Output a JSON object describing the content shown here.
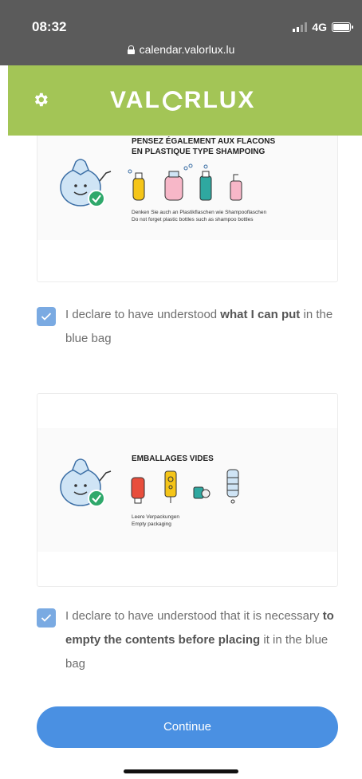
{
  "status_bar": {
    "time": "08:32",
    "network": "4G",
    "url": "calendar.valorlux.lu"
  },
  "header": {
    "logo_left": "VAL",
    "logo_right": "RLUX",
    "settings_icon": "gear-icon",
    "color": "#a3c556"
  },
  "cards": [
    {
      "title_line1": "PENSEZ ÉGALEMENT AUX FLACONS",
      "title_line2": "EN PLASTIQUE TYPE SHAMPOING",
      "sub_line1": "Denken Sie auch an Plastikflaschen wie Shampooflaschen",
      "sub_line2": "Do not forget plastic bottles such as shampoo bottles"
    },
    {
      "title_line1": "EMBALLAGES VIDES",
      "sub_line1": "Leere Verpackungen",
      "sub_line2": "Empty packaging"
    }
  ],
  "declarations": [
    {
      "part1": "I declare to have understood ",
      "bold1": "what I can put",
      "part2": " in the blue bag",
      "checked": true
    },
    {
      "part1": "I declare to have understood that it is necessary ",
      "bold1": "to empty the contents before placing",
      "part2": " it in the blue bag",
      "checked": true
    }
  ],
  "continue_label": "Continue",
  "colors": {
    "accent": "#4a90e2",
    "checkbox": "#7aaae2",
    "bag": "#cfe4f5",
    "check_badge": "#2fa86b"
  }
}
